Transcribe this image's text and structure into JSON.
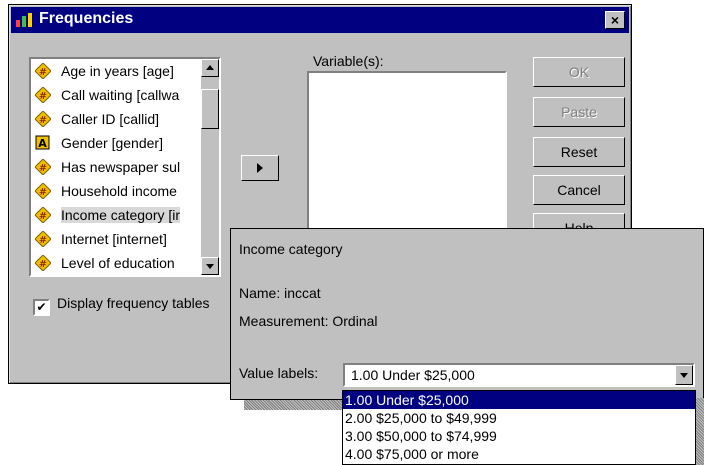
{
  "window": {
    "title": "Frequencies",
    "close_label": "×"
  },
  "source_list": {
    "items": [
      {
        "label": "Age in years [age]",
        "icon": "scale-variable-icon"
      },
      {
        "label": "Call waiting [callwa",
        "icon": "scale-variable-icon"
      },
      {
        "label": "Caller ID [callid]",
        "icon": "scale-variable-icon"
      },
      {
        "label": "Gender [gender]",
        "icon": "string-variable-icon"
      },
      {
        "label": "Has newspaper sul",
        "icon": "scale-variable-icon"
      },
      {
        "label": "Household income",
        "icon": "scale-variable-icon"
      },
      {
        "label": "Income category [ir",
        "icon": "scale-variable-icon"
      },
      {
        "label": "Internet [internet]",
        "icon": "scale-variable-icon"
      },
      {
        "label": "Level of education",
        "icon": "scale-variable-icon"
      }
    ],
    "selected_index": 6
  },
  "variables": {
    "label": "Variable(s):"
  },
  "buttons": {
    "ok": "OK",
    "paste": "Paste",
    "reset": "Reset",
    "cancel": "Cancel",
    "help": "Help"
  },
  "checkbox": {
    "label": "Display frequency tables",
    "checked": true,
    "mark": "✔"
  },
  "popup": {
    "title": "Income category",
    "name": "Name:  inccat",
    "measurement": "Measurement:  Ordinal",
    "value_labels_label": "Value labels:",
    "value_labels_selected": "1.00 Under $25,000",
    "options": [
      "1.00 Under $25,000",
      "2.00 $25,000 to $49,999",
      "3.00 $50,000 to $74,999",
      "4.00 $75,000 or more"
    ]
  },
  "colors": {
    "titlebar": "#000080",
    "dialog_bg": "#c0c0c0",
    "selection": "#000080"
  }
}
